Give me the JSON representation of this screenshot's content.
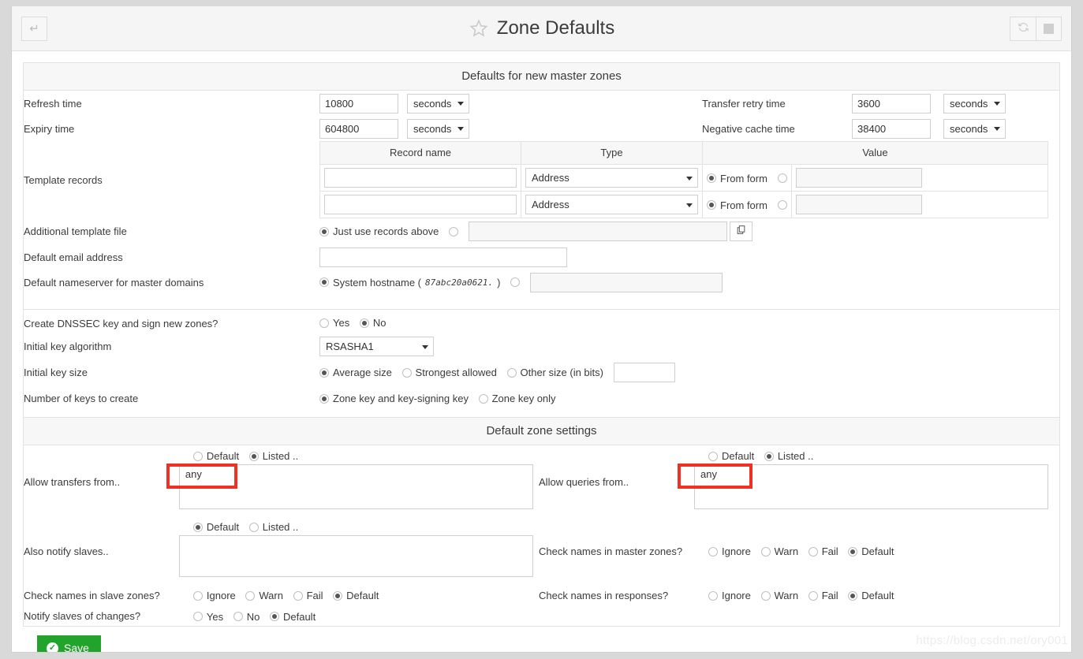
{
  "header": {
    "back_icon": "arrow-left-enter-icon",
    "star_icon": "star-icon",
    "title": "Zone Defaults",
    "refresh_icon": "refresh-icon",
    "stop_icon": "stop-square-icon"
  },
  "section1": {
    "title": "Defaults for new master zones",
    "refresh_time": {
      "label": "Refresh time",
      "value": "10800",
      "unit": "seconds"
    },
    "expiry_time": {
      "label": "Expiry time",
      "value": "604800",
      "unit": "seconds"
    },
    "transfer_retry_time": {
      "label": "Transfer retry time",
      "value": "3600",
      "unit": "seconds"
    },
    "negative_cache_time": {
      "label": "Negative cache time",
      "value": "38400",
      "unit": "seconds"
    },
    "template_records": {
      "label": "Template records",
      "columns": [
        "Record name",
        "Type",
        "Value"
      ],
      "rows": [
        {
          "name": "",
          "type": "Address",
          "value_mode": "From form",
          "value": ""
        },
        {
          "name": "",
          "type": "Address",
          "value_mode": "From form",
          "value": ""
        }
      ]
    },
    "additional_template_file": {
      "label": "Additional template file",
      "option_default": "Just use records above",
      "value": "",
      "file_chooser_icon": "file-chooser-icon"
    },
    "default_email_address": {
      "label": "Default email address",
      "value": ""
    },
    "default_nameserver": {
      "label": "Default nameserver for master domains",
      "option_system": "System hostname (",
      "hostname": "87abc20a0621.",
      "option_system_close": ")",
      "value": ""
    }
  },
  "section2": {
    "dnssec": {
      "label": "Create DNSSEC key and sign new zones?",
      "options": [
        "Yes",
        "No"
      ],
      "selected": "No"
    },
    "key_algorithm": {
      "label": "Initial key algorithm",
      "value": "RSASHA1"
    },
    "key_size": {
      "label": "Initial key size",
      "options": [
        "Average size",
        "Strongest allowed",
        "Other size (in bits)"
      ],
      "selected": "Average size",
      "other_value": ""
    },
    "num_keys": {
      "label": "Number of keys to create",
      "options": [
        "Zone key and key-signing key",
        "Zone key only"
      ],
      "selected": "Zone key and key-signing key"
    }
  },
  "section3": {
    "title": "Default zone settings",
    "allow_transfers": {
      "label": "Allow transfers from..",
      "options": [
        "Default",
        "Listed .."
      ],
      "selected": "Listed ..",
      "value": "any"
    },
    "allow_queries": {
      "label": "Allow queries from..",
      "options": [
        "Default",
        "Listed .."
      ],
      "selected": "Listed ..",
      "value": "any"
    },
    "also_notify": {
      "label": "Also notify slaves..",
      "options": [
        "Default",
        "Listed .."
      ],
      "selected": "Default",
      "value": ""
    },
    "check_master": {
      "label": "Check names in master zones?",
      "options": [
        "Ignore",
        "Warn",
        "Fail",
        "Default"
      ],
      "selected": "Default"
    },
    "check_slave": {
      "label": "Check names in slave zones?",
      "options": [
        "Ignore",
        "Warn",
        "Fail",
        "Default"
      ],
      "selected": "Default"
    },
    "check_responses": {
      "label": "Check names in responses?",
      "options": [
        "Ignore",
        "Warn",
        "Fail",
        "Default"
      ],
      "selected": "Default"
    },
    "notify_slaves": {
      "label": "Notify slaves of changes?",
      "options": [
        "Yes",
        "No",
        "Default"
      ],
      "selected": "Default"
    }
  },
  "footer": {
    "save_label": "Save",
    "save_icon": "check-circle-icon",
    "save_color": "#22a32c"
  },
  "watermark": "https://blog.csdn.net/ory001"
}
